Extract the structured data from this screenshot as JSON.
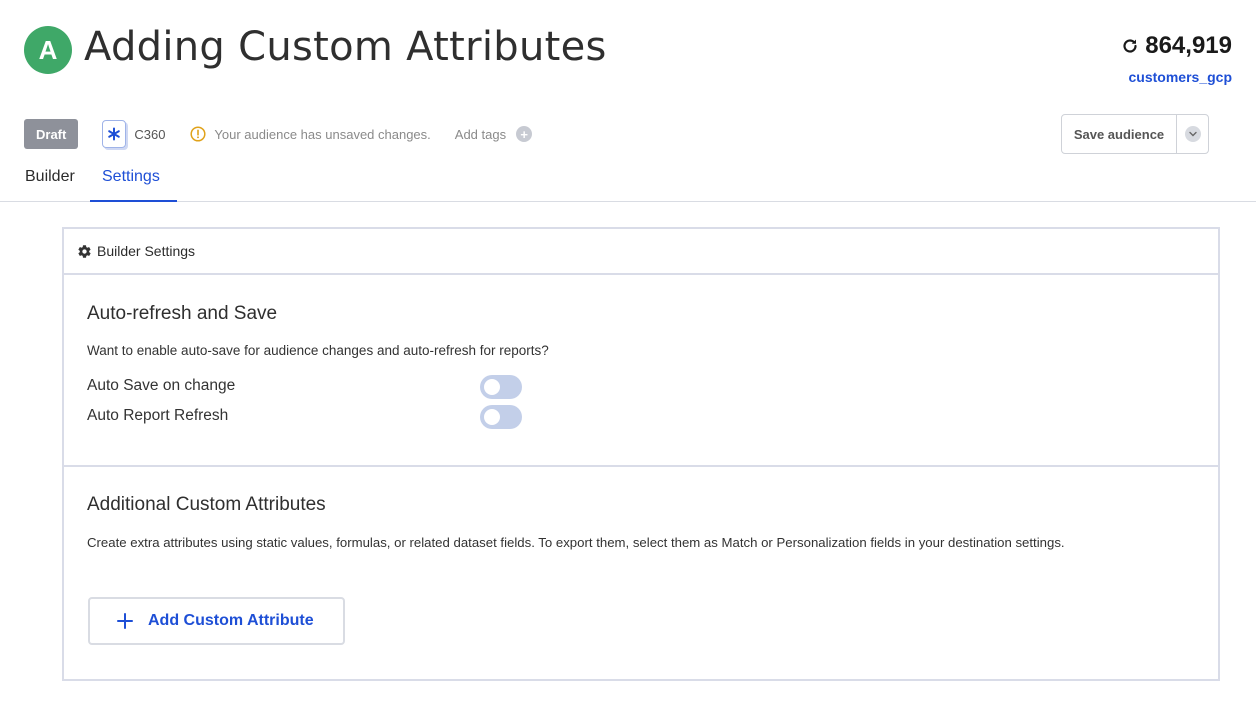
{
  "header": {
    "avatar_letter": "A",
    "title": "Adding Custom Attributes",
    "audience_count": "864,919",
    "dataset_link": "customers_gcp"
  },
  "meta": {
    "status_badge": "Draft",
    "source_label": "C360",
    "warning_text": "Your audience has unsaved changes.",
    "add_tags_label": "Add tags",
    "save_label": "Save audience"
  },
  "tabs": [
    {
      "label": "Builder",
      "active": false
    },
    {
      "label": "Settings",
      "active": true
    }
  ],
  "panel": {
    "title": "Builder Settings",
    "auto_refresh": {
      "heading": "Auto-refresh and Save",
      "description": "Want to enable auto-save for audience changes and auto-refresh for reports?",
      "toggles": [
        {
          "label": "Auto Save on change",
          "enabled": false
        },
        {
          "label": "Auto Report Refresh",
          "enabled": false
        }
      ]
    },
    "custom_attributes": {
      "heading": "Additional Custom Attributes",
      "description": "Create extra attributes using static values, formulas, or related dataset fields. To export them, select them as Match or Personalization fields in your destination settings.",
      "add_button_label": "Add Custom Attribute"
    }
  },
  "colors": {
    "accent": "#1e4fd6",
    "avatar": "#3fa868",
    "draft_badge": "#8e919a",
    "warning": "#e0a21a",
    "toggle_off": "#c3cfe9"
  },
  "icons": {
    "refresh": "refresh-icon",
    "source": "c360-source-icon",
    "warning": "warning-icon",
    "add_tags": "plus-circle-icon",
    "save_menu": "chevron-down-icon",
    "settings": "gear-icon",
    "add": "plus-icon"
  }
}
